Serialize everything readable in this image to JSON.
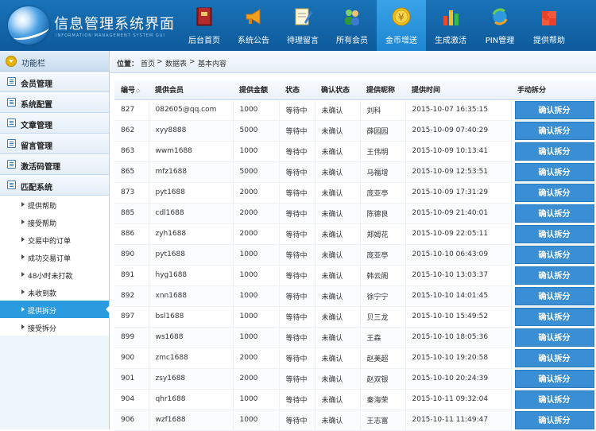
{
  "header": {
    "title": "信息管理系统界面",
    "subtitle": "INFORMATION MANAGEMENT SYSTEM GUI",
    "nav": [
      {
        "label": "后台首页",
        "icon": "book-icon"
      },
      {
        "label": "系统公告",
        "icon": "megaphone-icon"
      },
      {
        "label": "待理留言",
        "icon": "notepad-pencil-icon"
      },
      {
        "label": "所有会员",
        "icon": "users-icon"
      },
      {
        "label": "金币增送",
        "icon": "gold-coin-icon",
        "active": true
      },
      {
        "label": "生成激活",
        "icon": "bar-chart-icon"
      },
      {
        "label": "PIN管理",
        "icon": "refresh-globe-icon"
      },
      {
        "label": "提供帮助",
        "icon": "puzzle-icon"
      }
    ]
  },
  "sidebar": {
    "title": "功能栏",
    "groups": [
      {
        "label": "会员管理"
      },
      {
        "label": "系统配置"
      },
      {
        "label": "文章管理"
      },
      {
        "label": "留言管理"
      },
      {
        "label": "激活码管理"
      },
      {
        "label": "匹配系统"
      }
    ],
    "subitems": [
      {
        "label": "提供帮助"
      },
      {
        "label": "接受帮助"
      },
      {
        "label": "交易中的订单"
      },
      {
        "label": "成功交易订单"
      },
      {
        "label": "48小时未打款"
      },
      {
        "label": "未收到款"
      },
      {
        "label": "提供拆分",
        "active": true
      },
      {
        "label": "接受拆分"
      }
    ]
  },
  "breadcrumb": {
    "label": "位置：",
    "items": [
      "首页",
      "数据表",
      "基本内容"
    ]
  },
  "table": {
    "headers": [
      "编号",
      "提供会员",
      "提供金额",
      "状态",
      "确认状态",
      "提供昵称",
      "提供时间",
      "手动拆分"
    ],
    "sort_indicator": "◇",
    "action_label": "确认拆分",
    "rows": [
      [
        "827",
        "082605@qq.com",
        "1000",
        "等待中",
        "未确认",
        "刘科",
        "2015-10-07 16:35:15"
      ],
      [
        "862",
        "xyy8888",
        "5000",
        "等待中",
        "未确认",
        "薛园园",
        "2015-10-09 07:40:29"
      ],
      [
        "863",
        "wwm1688",
        "1000",
        "等待中",
        "未确认",
        "王伟明",
        "2015-10-09 10:13:41"
      ],
      [
        "865",
        "mfz1688",
        "5000",
        "等待中",
        "未确认",
        "马福增",
        "2015-10-09 12:53:51"
      ],
      [
        "873",
        "pyt1688",
        "2000",
        "等待中",
        "未确认",
        "庞亚亭",
        "2015-10-09 17:31:29"
      ],
      [
        "885",
        "cdl1688",
        "2000",
        "等待中",
        "未确认",
        "陈德良",
        "2015-10-09 21:40:01"
      ],
      [
        "886",
        "zyh1688",
        "2000",
        "等待中",
        "未确认",
        "郑姆花",
        "2015-10-09 22:05:11"
      ],
      [
        "890",
        "pyt1688",
        "1000",
        "等待中",
        "未确认",
        "庞亚亭",
        "2015-10-10 06:43:09"
      ],
      [
        "891",
        "hyg1688",
        "1000",
        "等待中",
        "未确认",
        "韩云阁",
        "2015-10-10 13:03:37"
      ],
      [
        "892",
        "xnn1688",
        "1000",
        "等待中",
        "未确认",
        "徐宁宁",
        "2015-10-10 14:01:45"
      ],
      [
        "897",
        "bsl1688",
        "1000",
        "等待中",
        "未确认",
        "贝三龙",
        "2015-10-10 15:49:52"
      ],
      [
        "899",
        "ws1688",
        "1000",
        "等待中",
        "未确认",
        "王森",
        "2015-10-10 18:05:36"
      ],
      [
        "900",
        "zmc1688",
        "2000",
        "等待中",
        "未确认",
        "赵美超",
        "2015-10-10 19:20:58"
      ],
      [
        "901",
        "zsy1688",
        "2000",
        "等待中",
        "未确认",
        "赵双银",
        "2015-10-10 20:24:39"
      ],
      [
        "904",
        "qhr1688",
        "1000",
        "等待中",
        "未确认",
        "秦海荣",
        "2015-10-11 09:32:04"
      ],
      [
        "906",
        "wzf1688",
        "1000",
        "等待中",
        "未确认",
        "王志富",
        "2015-10-11 11:49:47"
      ]
    ]
  },
  "colors": {
    "header_bg": "#0d5a9b",
    "active_nav": "#2b9be0",
    "button_bg": "#3a8fd4",
    "sidebar_active": "#2b9be0"
  }
}
